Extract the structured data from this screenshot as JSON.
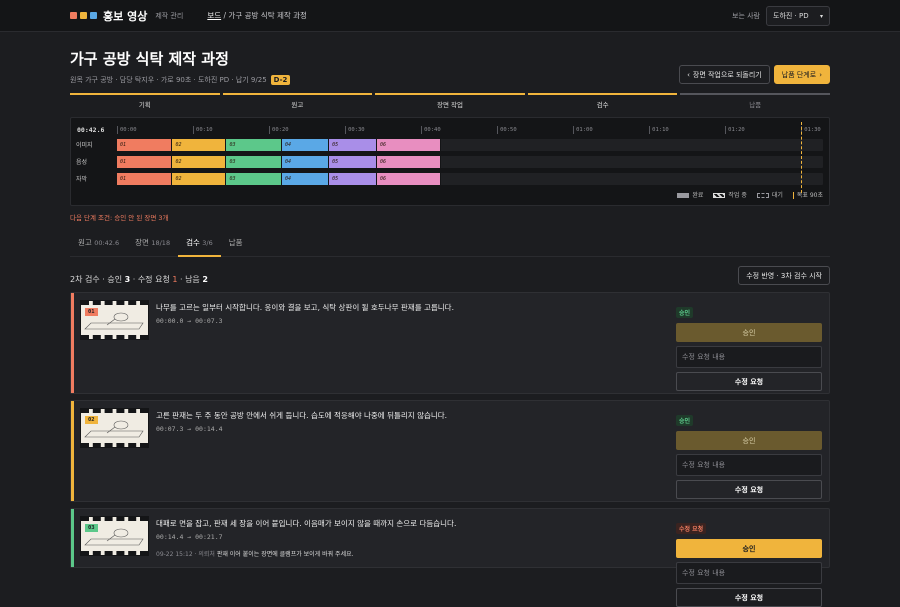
{
  "topbar": {
    "brand": "홍보 영상",
    "subtitle": "제작 관리",
    "breadcrumb_link": "보드",
    "breadcrumb_sep": " / ",
    "breadcrumb_current": "가구 공방 식탁 제작 과정",
    "viewer_label": "보는 사람",
    "viewer_value": "도하진 · PD",
    "logo_colors": [
      "#f07c60",
      "#f0b43c",
      "#5aa8e6"
    ]
  },
  "header": {
    "title": "가구 공방 식탁 제작 과정",
    "meta": "원목 가구 공방 · 담당 탁지우 · 가로 90초 · 도하진 PD · 납기 9/25",
    "dday": "D-2",
    "back_button": "장면 작업으로 되돌리기",
    "next_button": "납품 단계로"
  },
  "stages": [
    {
      "label": "기획",
      "done": true
    },
    {
      "label": "원고",
      "done": true
    },
    {
      "label": "장면 작업",
      "done": true
    },
    {
      "label": "검수",
      "done": true
    },
    {
      "label": "납품",
      "done": false
    }
  ],
  "timeline": {
    "current_time": "00:42.6",
    "ticks": [
      "00:00",
      "00:10",
      "00:20",
      "00:30",
      "00:40",
      "00:50",
      "01:00",
      "01:10",
      "01:20",
      "01:30"
    ],
    "tick_seconds": [
      0,
      10,
      20,
      30,
      40,
      50,
      60,
      70,
      80,
      90
    ],
    "total_seconds": 93,
    "target_seconds": 90,
    "rows": [
      {
        "label": "이미지"
      },
      {
        "label": "음성"
      },
      {
        "label": "자막"
      }
    ],
    "clips": [
      {
        "label": "01",
        "start": 0,
        "end": 7.3,
        "color": "#f07c60"
      },
      {
        "label": "02",
        "start": 7.3,
        "end": 14.4,
        "color": "#f0b43c"
      },
      {
        "label": "03",
        "start": 14.4,
        "end": 21.7,
        "color": "#5cc88a"
      },
      {
        "label": "04",
        "start": 21.7,
        "end": 27.9,
        "color": "#5aa8e6"
      },
      {
        "label": "05",
        "start": 27.9,
        "end": 34.2,
        "color": "#a98ee8"
      },
      {
        "label": "06",
        "start": 34.2,
        "end": 42.6,
        "color": "#e88ec0"
      }
    ],
    "legend": {
      "done": "완료",
      "working": "작업 중",
      "waiting": "대기",
      "target": "목표 90초"
    }
  },
  "next_condition": "다음 단계 조건: 승인 안 된 장면 3개",
  "tabs": [
    {
      "label": "원고",
      "count": "00:42.6",
      "active": false
    },
    {
      "label": "장면",
      "count": "18/18",
      "active": false
    },
    {
      "label": "검수",
      "count": "3/6",
      "active": true
    },
    {
      "label": "납품",
      "count": "",
      "active": false
    }
  ],
  "summary": {
    "prefix": "2차 검수 · 승인 ",
    "approved": "3",
    "mid": " · 수정 요청 ",
    "revisions": "1",
    "mid2": " · 남음 ",
    "remaining": "2",
    "resubmit_button": "수정 반영 · 3차 검수 시작"
  },
  "cards": [
    {
      "num": "01",
      "color": "#f07c60",
      "text": "나무를 고르는 일부터 시작합니다. 옹이와 결을 보고, 식탁 상판이 될 호두나무 판재를 고릅니다.",
      "range": "00:00.0 → 00:07.3",
      "status": "승인",
      "status_kind": "ok",
      "approve_label": "승인",
      "input_placeholder": "수정 요청 내용",
      "request_label": "수정 요청",
      "comment_meta": "",
      "comment_text": ""
    },
    {
      "num": "02",
      "color": "#f0b43c",
      "text": "고른 판재는 두 주 동안 공방 안에서 쉬게 둡니다. 습도에 적응해야 나중에 뒤틀리지 않습니다.",
      "range": "00:07.3 → 00:14.4",
      "status": "승인",
      "status_kind": "ok",
      "approve_label": "승인",
      "input_placeholder": "수정 요청 내용",
      "request_label": "수정 요청",
      "comment_meta": "",
      "comment_text": ""
    },
    {
      "num": "03",
      "color": "#5cc88a",
      "text": "대패로 면을 잡고, 판재 세 장을 이어 붙입니다. 이음매가 보이지 않을 때까지 손으로 다듬습니다.",
      "range": "00:14.4 → 00:21.7",
      "status": "수정 요청",
      "status_kind": "rev",
      "approve_label": "승인",
      "input_placeholder": "수정 요청 내용",
      "request_label": "수정 요청",
      "comment_meta": "09-22 15:12 · 의뢰처 ",
      "comment_text": "판재 이어 붙이는 장면에 클램프가 보이게 바꿔 주세요."
    }
  ]
}
